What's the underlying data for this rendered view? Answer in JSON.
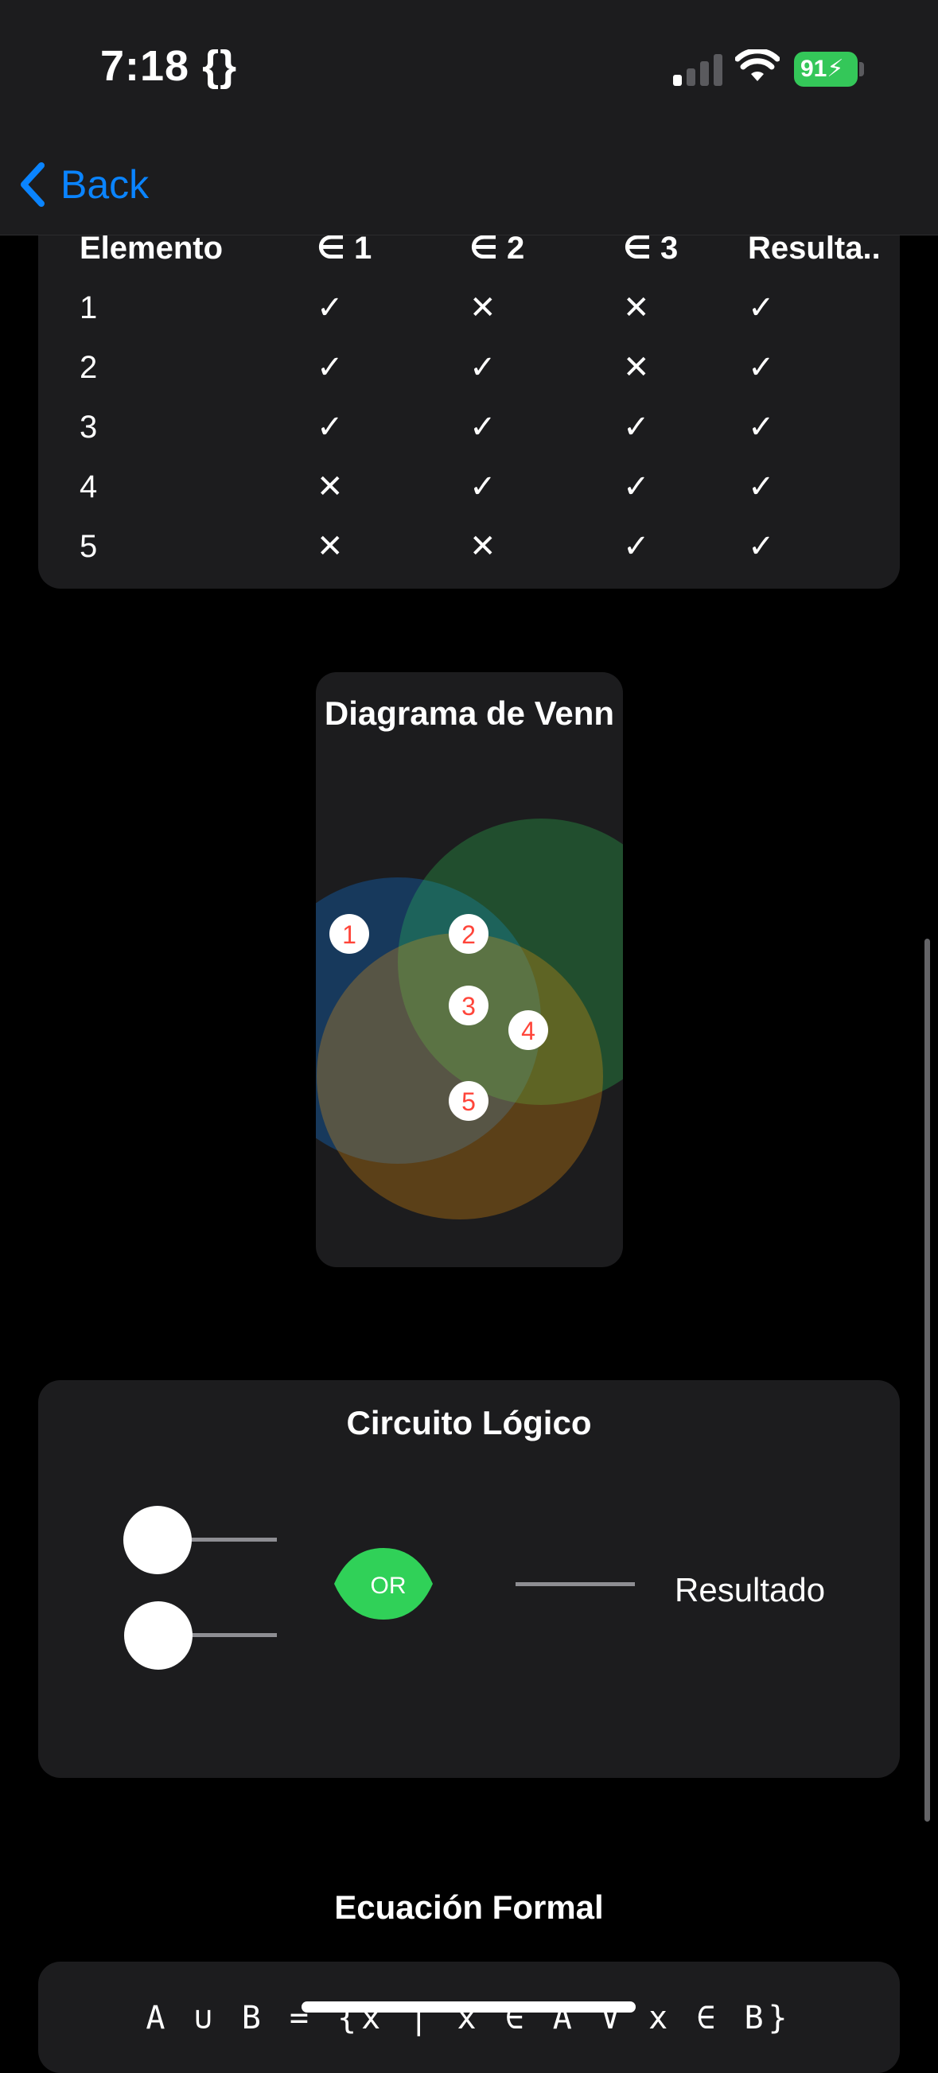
{
  "status": {
    "time": "7:18 {}",
    "battery": "91"
  },
  "nav": {
    "back_label": "Back"
  },
  "table": {
    "headers": [
      "Elemento",
      "∈ 1",
      "∈ 2",
      "∈ 3",
      "Resulta.."
    ],
    "rows": [
      [
        "1",
        "✓",
        "✕",
        "✕",
        "✓"
      ],
      [
        "2",
        "✓",
        "✓",
        "✕",
        "✓"
      ],
      [
        "3",
        "✓",
        "✓",
        "✓",
        "✓"
      ],
      [
        "4",
        "✕",
        "✓",
        "✓",
        "✓"
      ],
      [
        "5",
        "✕",
        "✕",
        "✓",
        "✓"
      ]
    ]
  },
  "venn": {
    "title": "Diagrama de Venn",
    "sets": [
      {
        "color": "#0a84ff"
      },
      {
        "color": "#30d158"
      },
      {
        "color": "#ff9f0a"
      }
    ],
    "elements": [
      "1",
      "2",
      "3",
      "4",
      "5"
    ],
    "element_color": "#ff453a"
  },
  "circuit": {
    "title": "Circuito Lógico",
    "gate_label": "OR",
    "gate_color": "#30d158",
    "output_label": "Resultado"
  },
  "equation": {
    "title": "Ecuación Formal",
    "text": "A ∪ B = {x | x ∈ A ∨ x ∈ B}"
  }
}
